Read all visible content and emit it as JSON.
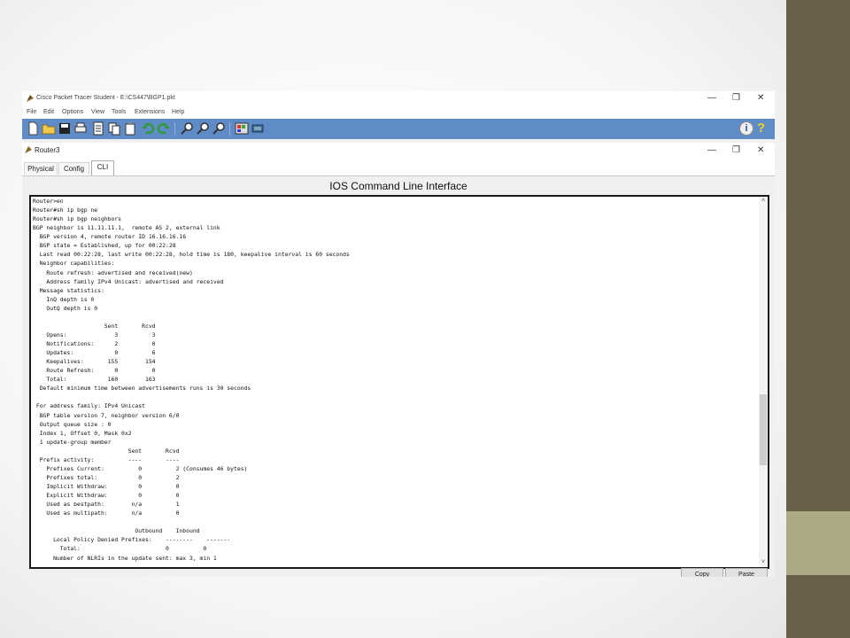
{
  "window": {
    "title": "Cisco Packet Tracer Student - E:\\CS447\\BGP1.pkt",
    "controls": [
      "—",
      "❐",
      "✕"
    ]
  },
  "menu": [
    "File",
    "Edit",
    "Options",
    "View",
    "Tools",
    "Extensions",
    "Help"
  ],
  "toolbar_icons": [
    "new-file-icon",
    "open-folder-icon",
    "save-icon",
    "print-icon",
    "activity-wizard-icon",
    "copy-icon",
    "paste-icon",
    "undo-icon",
    "redo-icon",
    "zoom-in-icon",
    "zoom-reset-icon",
    "zoom-out-icon",
    "palette-icon",
    "custom-device-icon"
  ],
  "toolbar_colors": {
    "bar": "#5f8bc6"
  },
  "device_window": {
    "title": "Router3",
    "controls": [
      "—",
      "❐",
      "✕"
    ],
    "tabs": [
      "Physical",
      "Config",
      "CLI"
    ],
    "active_tab": "CLI",
    "heading": "IOS Command Line Interface"
  },
  "cli_lines": [
    "Router>en",
    "Router#sh ip bgp ne",
    "Router#sh ip bgp neighbors",
    "BGP neighbor is 11.11.11.1,  remote AS 2, external link",
    "  BGP version 4, remote router ID 16.16.16.16",
    "  BGP state = Established, up for 00:22:28",
    "  Last read 00:22:28, last write 00:22:28, hold time is 180, keepalive interval is 60 seconds",
    "  Neighbor capabilities:",
    "    Route refresh: advertised and received(new)",
    "    Address family IPv4 Unicast: advertised and received",
    "  Message statistics:",
    "    InQ depth is 0",
    "    OutQ depth is 0",
    "",
    "                     Sent       Rcvd",
    "    Opens:              3          3",
    "    Notifications:      2          0",
    "    Updates:            0          6",
    "    Keepalives:       155        154",
    "    Route Refresh:      0          0",
    "    Total:            160        163",
    "  Default minimum time between advertisements runs is 30 seconds",
    "",
    " For address family: IPv4 Unicast",
    "  BGP table version 7, neighbor version 6/0",
    "  Output queue size : 0",
    "  Index 1, Offset 0, Mask 0x2",
    "  1 update-group member",
    "                            Sent       Rcvd",
    "  Prefix activity:          ----       ----",
    "    Prefixes Current:          0          2 (Consumes 46 bytes)",
    "    Prefixes total:            0          2",
    "    Implicit Withdraw:         0          0",
    "    Explicit Withdraw:         0          0",
    "    Used as bestpath:        n/a          1",
    "    Used as multipath:       n/a          0",
    "",
    "                              Outbound    Inbound",
    "      Local Policy Denied Prefixes:    --------    -------",
    "        Total:                         0          0",
    "      Number of NLRIs in the update sent: max 3, min 1"
  ],
  "buttons": {
    "copy": "Copy",
    "paste": "Paste"
  },
  "scroll_arrows": {
    "up": "˄",
    "down": "˅"
  }
}
